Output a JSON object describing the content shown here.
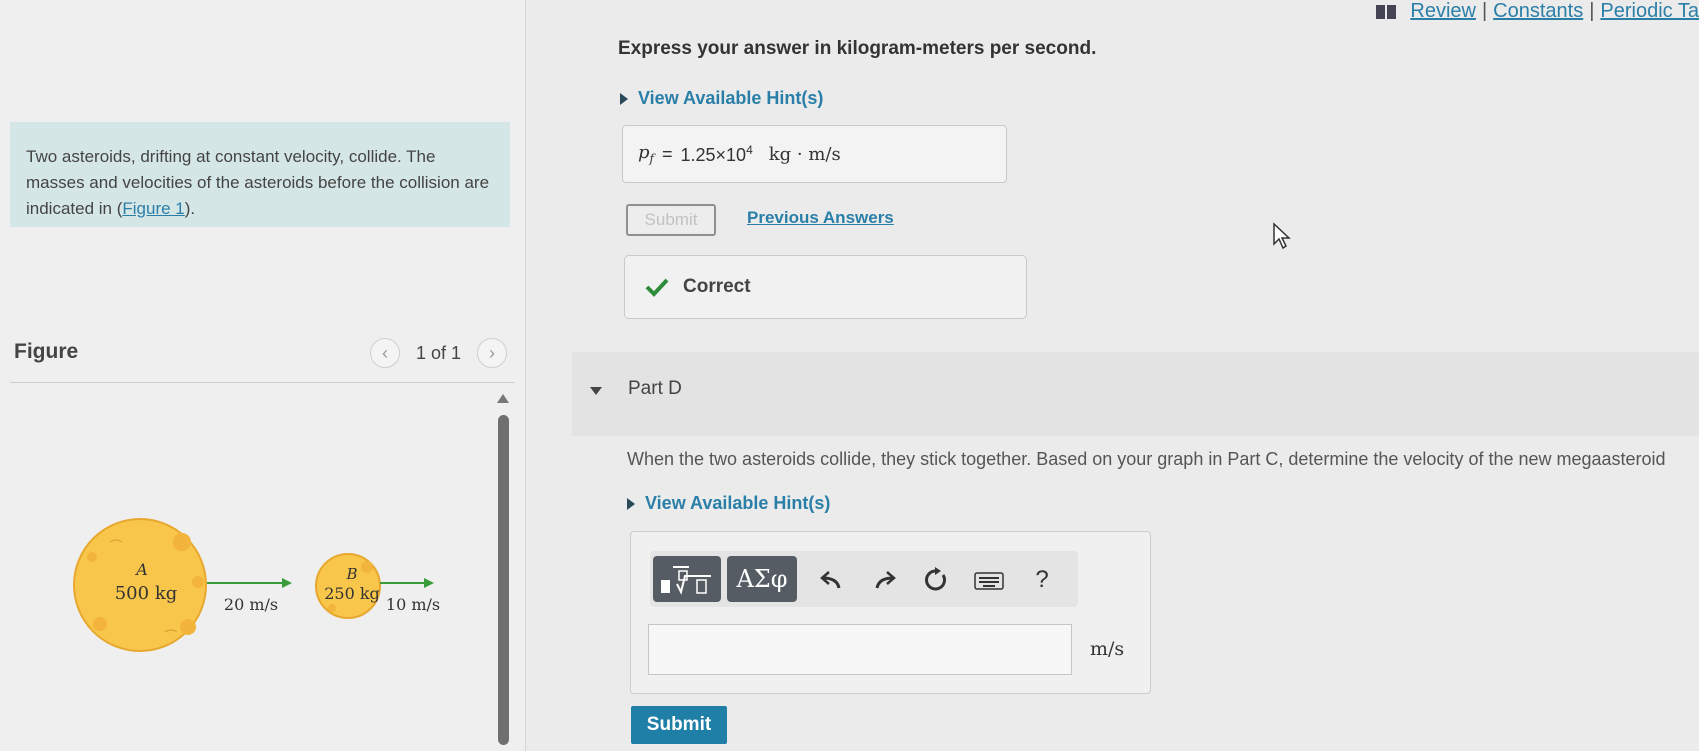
{
  "top_links": {
    "review": "Review",
    "constants": "Constants",
    "periodic": "Periodic Ta",
    "sep": "|"
  },
  "intro": {
    "text": "Two asteroids, drifting at constant velocity, collide. The masses and velocities of the asteroids before the collision are indicated in (",
    "link": "Figure 1",
    "text_end": ")."
  },
  "figure": {
    "label": "Figure",
    "pager": "1 of 1",
    "asteroid_a": {
      "name": "A",
      "mass": "500 kg",
      "speed": "20 m/s"
    },
    "asteroid_b": {
      "name": "B",
      "mass": "250 kg",
      "speed": "10 m/s"
    }
  },
  "prev_part": {
    "instruction": "Express your answer in kilogram-meters per second.",
    "hint": "View Available Hint(s)",
    "answer": {
      "variable": "p",
      "subscript": "f",
      "equals": "=",
      "value": "1.25×10",
      "exponent": "4",
      "unit": "kg · m/s"
    },
    "submit": "Submit",
    "previous_answers": "Previous Answers",
    "feedback": "Correct"
  },
  "part_d": {
    "title": "Part D",
    "question": "When the two asteroids collide, they stick together. Based on your graph in Part C, determine the velocity of the new megaasteroid",
    "hint": "View Available Hint(s)",
    "toolbar": {
      "greek": "ΑΣφ",
      "help": "?"
    },
    "unit": "m/s",
    "submit": "Submit"
  },
  "colors": {
    "accent": "#2a7fa8",
    "submit_bg": "#1f7fa6",
    "intro_bg": "#d5e6e6",
    "check": "#2e8b3a",
    "asteroid": "#f7c64a",
    "arrow": "#3a9b3a"
  }
}
